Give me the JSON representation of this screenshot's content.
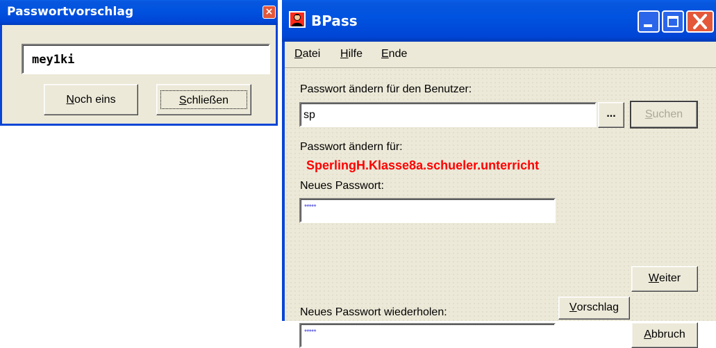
{
  "suggestion_window": {
    "title": "Passwortvorschlag",
    "close_glyph": "×",
    "suggested_password": "mey1ki",
    "noch_eins_label": {
      "mnemonic": "N",
      "rest": "och eins"
    },
    "schliessen_label": {
      "mnemonic": "S",
      "rest": "chließen"
    }
  },
  "main_window": {
    "title": "BPass",
    "menu": {
      "datei": {
        "mnemonic": "D",
        "rest": "atei"
      },
      "hilfe": {
        "mnemonic": "H",
        "rest": "ilfe"
      },
      "ende": {
        "mnemonic": "E",
        "rest": "nde"
      }
    },
    "label_change_for_user": "Passwort ändern für den Benutzer:",
    "user_value": "sp",
    "browse_label": "...",
    "search_label": {
      "mnemonic": "S",
      "rest": "uchen"
    },
    "label_change_for": "Passwort ändern für:",
    "user_path": "SperlingH.Klasse8a.schueler.unterricht",
    "label_new_password": "Neues Passwort:",
    "new_password_mask": "*****",
    "label_repeat_password": "Neues Passwort wiederholen:",
    "repeat_password_mask": "*****",
    "weiter_label": {
      "mnemonic": "W",
      "rest": "eiter"
    },
    "vorschlag_label": {
      "mnemonic": "V",
      "rest": "orschlag"
    },
    "abbruch_label": {
      "mnemonic": "A",
      "rest": "bbruch"
    }
  },
  "colors": {
    "titlebar": "#0053e0",
    "window_face": "#ece9d8",
    "close_button": "#e4583a",
    "user_path_text": "#ff0000",
    "disabled_text": "#aca899"
  },
  "icons": {
    "app_icon": "user-icon",
    "close": "close-icon",
    "minimize": "minimize-icon",
    "maximize": "maximize-icon"
  }
}
